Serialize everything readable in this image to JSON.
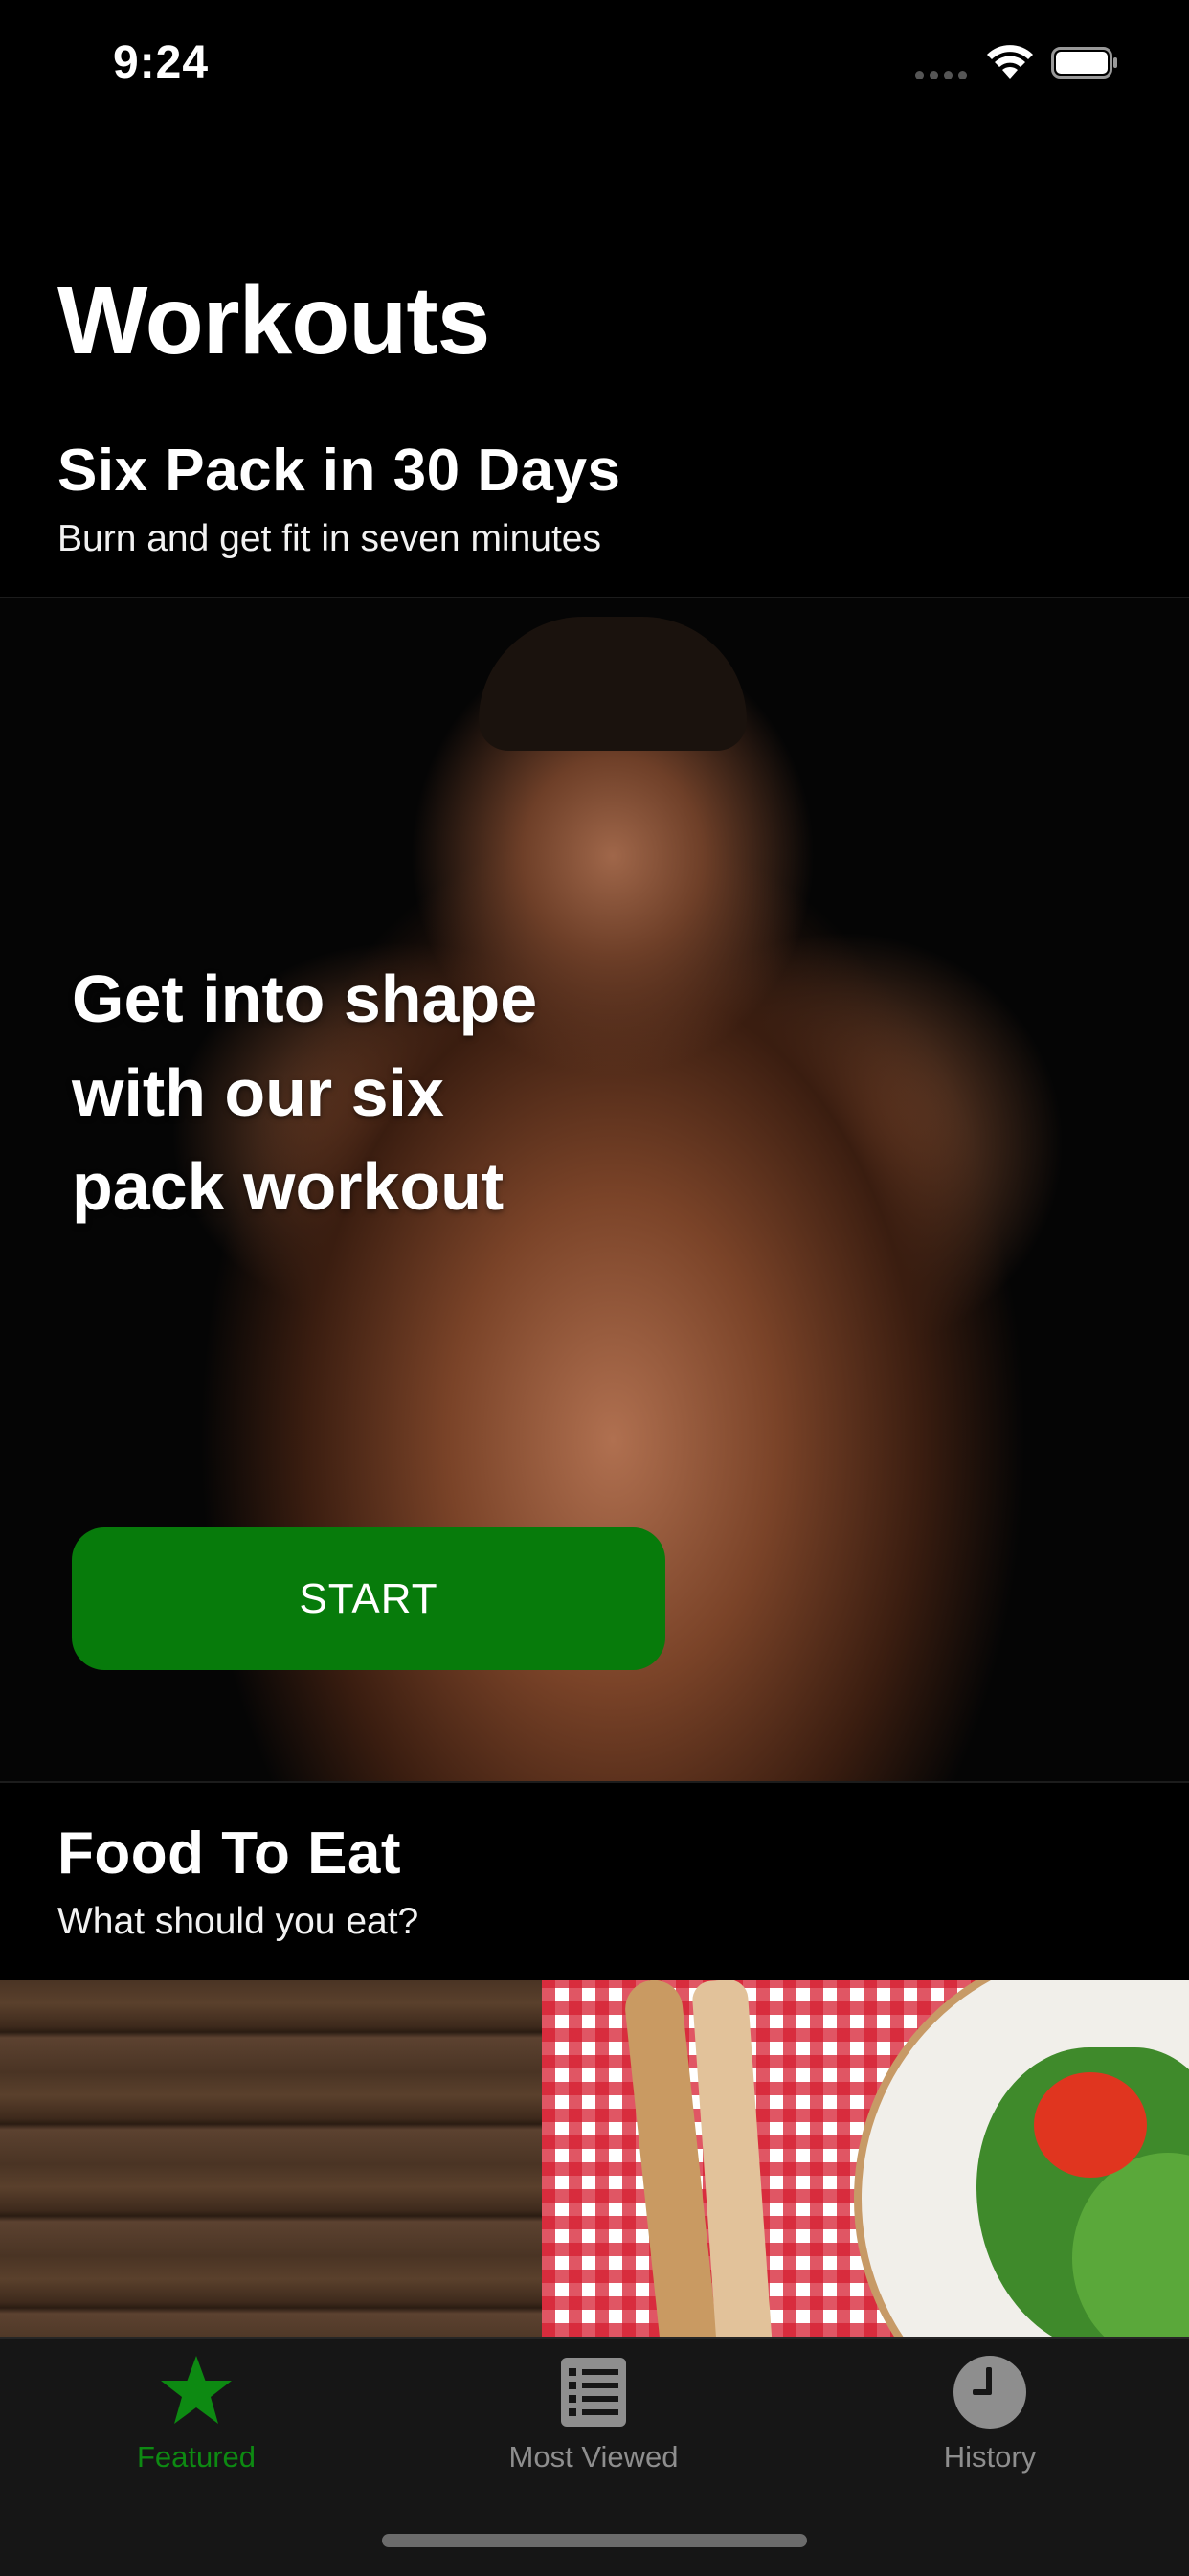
{
  "status_bar": {
    "time": "9:24"
  },
  "page": {
    "title": "Workouts"
  },
  "workout_section": {
    "title": "Six Pack in 30 Days",
    "subtitle": "Burn and get fit in seven minutes",
    "hero_lines": [
      "Get into shape",
      "with our six",
      "pack workout"
    ],
    "start_label": "START"
  },
  "food_section": {
    "title": "Food To Eat",
    "subtitle": "What should you eat?"
  },
  "tab_bar": {
    "items": [
      {
        "label": "Featured",
        "icon": "star-icon",
        "active": true
      },
      {
        "label": "Most Viewed",
        "icon": "list-icon",
        "active": false
      },
      {
        "label": "History",
        "icon": "clock-icon",
        "active": false
      }
    ]
  },
  "colors": {
    "accent": "#077b0b",
    "active_tab": "#0d8a12",
    "inactive_tab": "#8e8e8e",
    "background": "#000000",
    "tab_bar_background": "#161616"
  }
}
